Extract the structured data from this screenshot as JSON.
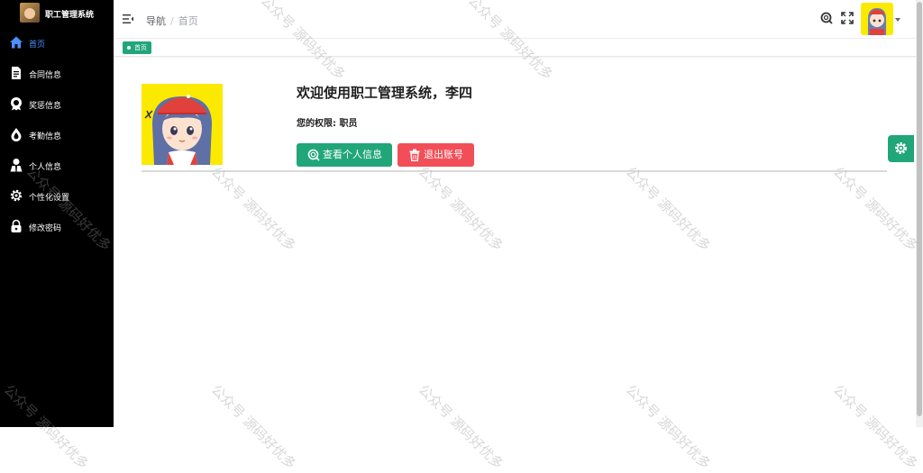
{
  "app": {
    "title": "职工管理系统"
  },
  "sidebar": {
    "items": [
      {
        "label": "首页",
        "icon": "home-icon",
        "active": true
      },
      {
        "label": "合同信息",
        "icon": "document-icon",
        "active": false
      },
      {
        "label": "奖惩信息",
        "icon": "award-icon",
        "active": false
      },
      {
        "label": "考勤信息",
        "icon": "attendance-icon",
        "active": false
      },
      {
        "label": "个人信息",
        "icon": "user-icon",
        "active": false
      },
      {
        "label": "个性化设置",
        "icon": "gear-icon",
        "active": false
      },
      {
        "label": "修改密码",
        "icon": "lock-icon",
        "active": false
      }
    ]
  },
  "header": {
    "breadcrumb": [
      "导航",
      "首页"
    ],
    "separator": "/"
  },
  "tags": [
    {
      "label": "首页",
      "active": true
    }
  ],
  "main": {
    "welcome": "欢迎使用职工管理系统，李四",
    "permission": "您的权限: 职员",
    "view_button": "查看个人信息",
    "logout_button": "退出账号"
  },
  "watermark": "公众号 源码好优多",
  "colors": {
    "sidebar_bg": "#000000",
    "accent": "#21a679",
    "danger": "#f24e58",
    "active_menu": "#4c8fff"
  }
}
